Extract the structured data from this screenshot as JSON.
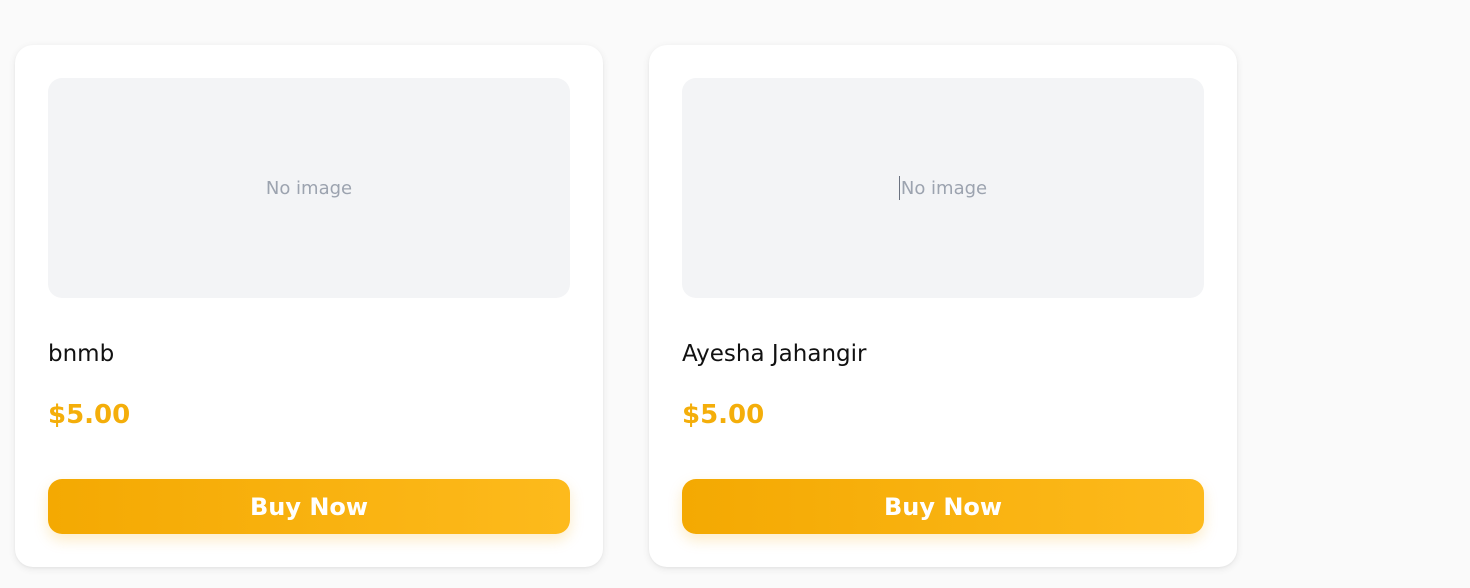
{
  "products": [
    {
      "image_placeholder": "No image",
      "name": "bnmb",
      "price": "$5.00",
      "button_label": "Buy Now"
    },
    {
      "image_placeholder": "No image",
      "name": "Ayesha Jahangir",
      "price": "$5.00",
      "button_label": "Buy Now"
    }
  ],
  "colors": {
    "price": "#f4ae0a",
    "button_start": "#f4a902",
    "button_end": "#fdba1c",
    "image_bg": "#f3f4f6",
    "page_bg": "#fafafa"
  }
}
